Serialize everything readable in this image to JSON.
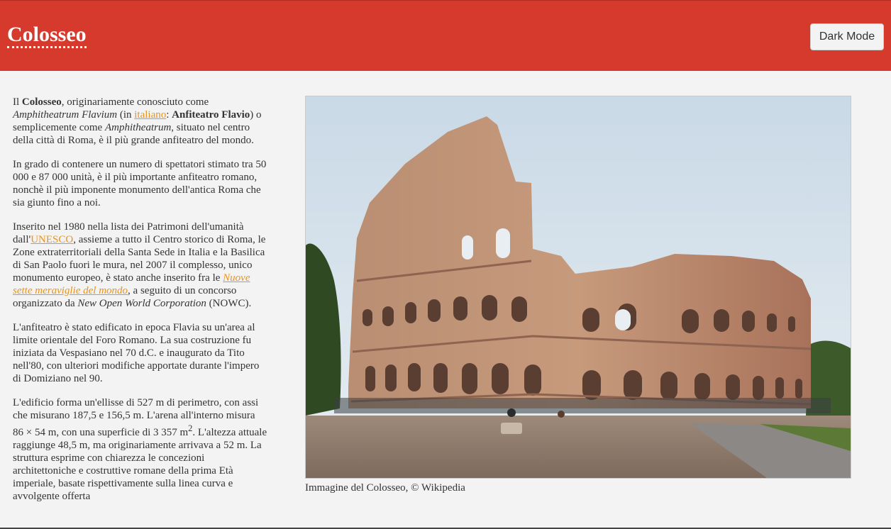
{
  "header": {
    "title": "Colosseo",
    "dark_mode_label": "Dark Mode"
  },
  "content": {
    "p1": {
      "t1": "Il ",
      "b1": "Colosseo",
      "t2": ", originariamente conosciuto come ",
      "i1": "Amphitheatrum Flavium",
      "t3": " (in ",
      "link": "italiano",
      "t4": ": ",
      "b2": "Anfiteatro Flavio",
      "t5": ") o semplicemente come ",
      "i2": "Amphitheatrum",
      "t6": ", situato nel centro della città di Roma, è il più grande anfiteatro del mondo."
    },
    "p2": "In grado di contenere un numero di spettatori stimato tra 50 000 e 87 000 unità, è il più importante anfiteatro romano, nonchè il più imponente monumento dell'antica Roma che sia giunto fino a noi.",
    "p3": {
      "t1": "Inserito nel 1980 nella lista dei Patrimoni dell'umanità dall'",
      "link1": "UNESCO",
      "t2": ", assieme a tutto il Centro storico di Roma, le Zone extraterritoriali della Santa Sede in Italia e la Basilica di San Paolo fuori le mura, nel 2007 il complesso, unico monumento europeo, è stato anche inserito fra le ",
      "link2": "Nuove sette meraviglie del mondo",
      "t3": ", a seguito di un concorso organizzato da ",
      "i1": "New Open World Corporation",
      "t4": " (NOWC)."
    },
    "p4": "L'anfiteatro è stato edificato in epoca Flavia su un'area al limite orientale del Foro Romano. La sua costruzione fu iniziata da Vespasiano nel 70 d.C. e inaugurato da Tito nell'80, con ulteriori modifiche apportate durante l'impero di Domiziano nel 90.",
    "p5": {
      "t1": "L'edificio forma un'ellisse di 527 m di perimetro, con assi che misurano 187,5 e 156,5 m. L'arena all'interno misura 86 × 54 m, con una superficie di 3 357 m",
      "sup": "2",
      "t2": ". L'altezza attuale raggiunge 48,5 m, ma originariamente arrivava a 52 m. La struttura esprime con chiarezza le concezioni architettoniche e costruttive romane della prima Età imperiale, basate rispettivamente sulla linea curva e avvolgente offerta"
    }
  },
  "figure": {
    "caption": "Immagine del Colosseo, © Wikipedia"
  }
}
